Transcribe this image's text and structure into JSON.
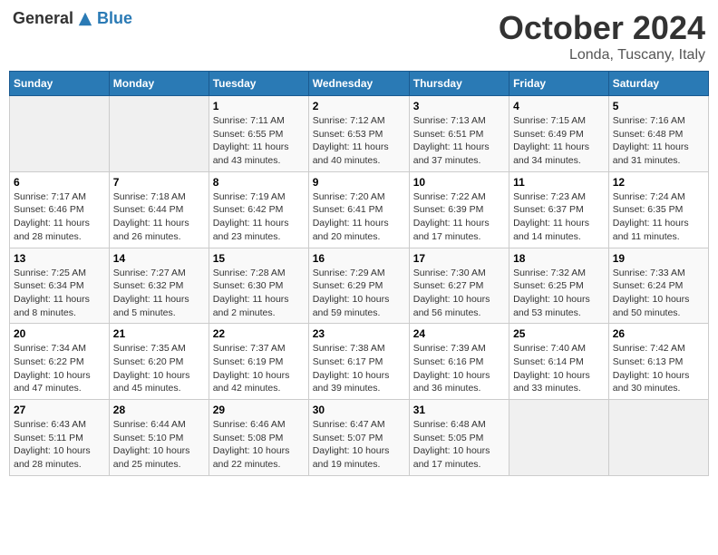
{
  "header": {
    "logo_general": "General",
    "logo_blue": "Blue",
    "month": "October 2024",
    "location": "Londa, Tuscany, Italy"
  },
  "weekdays": [
    "Sunday",
    "Monday",
    "Tuesday",
    "Wednesday",
    "Thursday",
    "Friday",
    "Saturday"
  ],
  "weeks": [
    [
      {
        "day": "",
        "info": ""
      },
      {
        "day": "",
        "info": ""
      },
      {
        "day": "1",
        "info": "Sunrise: 7:11 AM\nSunset: 6:55 PM\nDaylight: 11 hours and 43 minutes."
      },
      {
        "day": "2",
        "info": "Sunrise: 7:12 AM\nSunset: 6:53 PM\nDaylight: 11 hours and 40 minutes."
      },
      {
        "day": "3",
        "info": "Sunrise: 7:13 AM\nSunset: 6:51 PM\nDaylight: 11 hours and 37 minutes."
      },
      {
        "day": "4",
        "info": "Sunrise: 7:15 AM\nSunset: 6:49 PM\nDaylight: 11 hours and 34 minutes."
      },
      {
        "day": "5",
        "info": "Sunrise: 7:16 AM\nSunset: 6:48 PM\nDaylight: 11 hours and 31 minutes."
      }
    ],
    [
      {
        "day": "6",
        "info": "Sunrise: 7:17 AM\nSunset: 6:46 PM\nDaylight: 11 hours and 28 minutes."
      },
      {
        "day": "7",
        "info": "Sunrise: 7:18 AM\nSunset: 6:44 PM\nDaylight: 11 hours and 26 minutes."
      },
      {
        "day": "8",
        "info": "Sunrise: 7:19 AM\nSunset: 6:42 PM\nDaylight: 11 hours and 23 minutes."
      },
      {
        "day": "9",
        "info": "Sunrise: 7:20 AM\nSunset: 6:41 PM\nDaylight: 11 hours and 20 minutes."
      },
      {
        "day": "10",
        "info": "Sunrise: 7:22 AM\nSunset: 6:39 PM\nDaylight: 11 hours and 17 minutes."
      },
      {
        "day": "11",
        "info": "Sunrise: 7:23 AM\nSunset: 6:37 PM\nDaylight: 11 hours and 14 minutes."
      },
      {
        "day": "12",
        "info": "Sunrise: 7:24 AM\nSunset: 6:35 PM\nDaylight: 11 hours and 11 minutes."
      }
    ],
    [
      {
        "day": "13",
        "info": "Sunrise: 7:25 AM\nSunset: 6:34 PM\nDaylight: 11 hours and 8 minutes."
      },
      {
        "day": "14",
        "info": "Sunrise: 7:27 AM\nSunset: 6:32 PM\nDaylight: 11 hours and 5 minutes."
      },
      {
        "day": "15",
        "info": "Sunrise: 7:28 AM\nSunset: 6:30 PM\nDaylight: 11 hours and 2 minutes."
      },
      {
        "day": "16",
        "info": "Sunrise: 7:29 AM\nSunset: 6:29 PM\nDaylight: 10 hours and 59 minutes."
      },
      {
        "day": "17",
        "info": "Sunrise: 7:30 AM\nSunset: 6:27 PM\nDaylight: 10 hours and 56 minutes."
      },
      {
        "day": "18",
        "info": "Sunrise: 7:32 AM\nSunset: 6:25 PM\nDaylight: 10 hours and 53 minutes."
      },
      {
        "day": "19",
        "info": "Sunrise: 7:33 AM\nSunset: 6:24 PM\nDaylight: 10 hours and 50 minutes."
      }
    ],
    [
      {
        "day": "20",
        "info": "Sunrise: 7:34 AM\nSunset: 6:22 PM\nDaylight: 10 hours and 47 minutes."
      },
      {
        "day": "21",
        "info": "Sunrise: 7:35 AM\nSunset: 6:20 PM\nDaylight: 10 hours and 45 minutes."
      },
      {
        "day": "22",
        "info": "Sunrise: 7:37 AM\nSunset: 6:19 PM\nDaylight: 10 hours and 42 minutes."
      },
      {
        "day": "23",
        "info": "Sunrise: 7:38 AM\nSunset: 6:17 PM\nDaylight: 10 hours and 39 minutes."
      },
      {
        "day": "24",
        "info": "Sunrise: 7:39 AM\nSunset: 6:16 PM\nDaylight: 10 hours and 36 minutes."
      },
      {
        "day": "25",
        "info": "Sunrise: 7:40 AM\nSunset: 6:14 PM\nDaylight: 10 hours and 33 minutes."
      },
      {
        "day": "26",
        "info": "Sunrise: 7:42 AM\nSunset: 6:13 PM\nDaylight: 10 hours and 30 minutes."
      }
    ],
    [
      {
        "day": "27",
        "info": "Sunrise: 6:43 AM\nSunset: 5:11 PM\nDaylight: 10 hours and 28 minutes."
      },
      {
        "day": "28",
        "info": "Sunrise: 6:44 AM\nSunset: 5:10 PM\nDaylight: 10 hours and 25 minutes."
      },
      {
        "day": "29",
        "info": "Sunrise: 6:46 AM\nSunset: 5:08 PM\nDaylight: 10 hours and 22 minutes."
      },
      {
        "day": "30",
        "info": "Sunrise: 6:47 AM\nSunset: 5:07 PM\nDaylight: 10 hours and 19 minutes."
      },
      {
        "day": "31",
        "info": "Sunrise: 6:48 AM\nSunset: 5:05 PM\nDaylight: 10 hours and 17 minutes."
      },
      {
        "day": "",
        "info": ""
      },
      {
        "day": "",
        "info": ""
      }
    ]
  ]
}
